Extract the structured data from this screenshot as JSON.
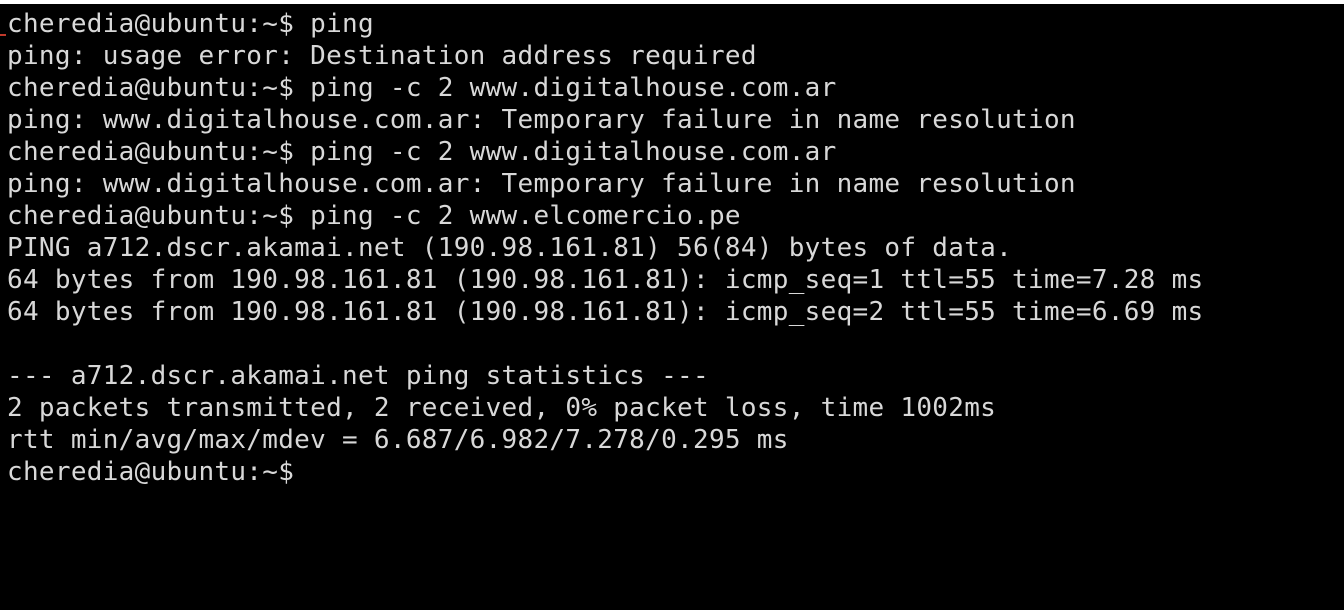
{
  "terminal": {
    "lines": [
      "cheredia@ubuntu:~$ ping",
      "ping: usage error: Destination address required",
      "cheredia@ubuntu:~$ ping -c 2 www.digitalhouse.com.ar",
      "ping: www.digitalhouse.com.ar: Temporary failure in name resolution",
      "cheredia@ubuntu:~$ ping -c 2 www.digitalhouse.com.ar",
      "ping: www.digitalhouse.com.ar: Temporary failure in name resolution",
      "cheredia@ubuntu:~$ ping -c 2 www.elcomercio.pe",
      "PING a712.dscr.akamai.net (190.98.161.81) 56(84) bytes of data.",
      "64 bytes from 190.98.161.81 (190.98.161.81): icmp_seq=1 ttl=55 time=7.28 ms",
      "64 bytes from 190.98.161.81 (190.98.161.81): icmp_seq=2 ttl=55 time=6.69 ms",
      "",
      "--- a712.dscr.akamai.net ping statistics ---",
      "2 packets transmitted, 2 received, 0% packet loss, time 1002ms",
      "rtt min/avg/max/mdev = 6.687/6.982/7.278/0.295 ms",
      "cheredia@ubuntu:~$"
    ],
    "colors": {
      "background": "#000000",
      "text": "#d8d8d8"
    }
  }
}
